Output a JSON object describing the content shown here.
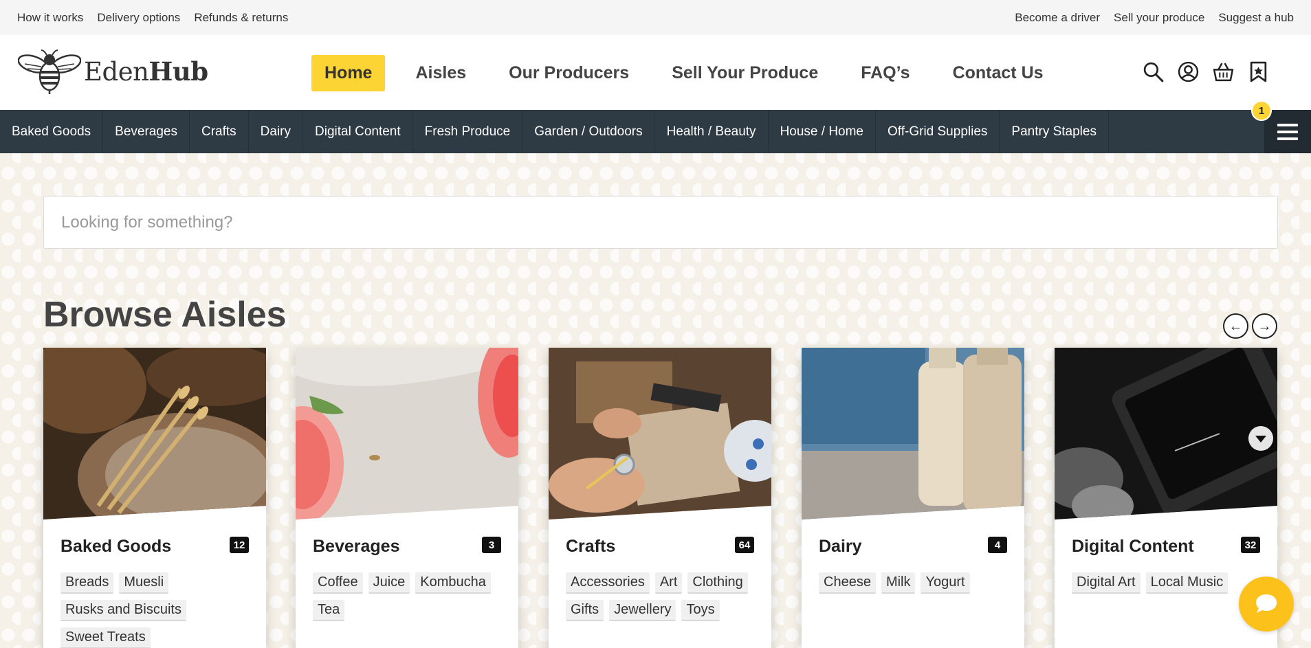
{
  "util_nav": {
    "left": [
      {
        "label": "How it works"
      },
      {
        "label": "Delivery options"
      },
      {
        "label": "Refunds & returns"
      }
    ],
    "right": [
      {
        "label": "Become a driver"
      },
      {
        "label": "Sell your produce"
      },
      {
        "label": "Suggest a hub"
      }
    ]
  },
  "brand": {
    "name_light": "Eden",
    "name_bold": "Hub",
    "icon": "bee-icon"
  },
  "main_nav": [
    {
      "label": "Home",
      "active": true
    },
    {
      "label": "Aisles"
    },
    {
      "label": "Our Producers"
    },
    {
      "label": "Sell Your Produce"
    },
    {
      "label": "FAQ’s"
    },
    {
      "label": "Contact Us"
    }
  ],
  "header_icons": [
    "search-icon",
    "user-icon",
    "basket-icon",
    "bookmark-icon"
  ],
  "cart_count": "1",
  "categories": [
    {
      "label": "Baked Goods"
    },
    {
      "label": "Beverages"
    },
    {
      "label": "Crafts"
    },
    {
      "label": "Dairy"
    },
    {
      "label": "Digital Content"
    },
    {
      "label": "Fresh Produce"
    },
    {
      "label": "Garden / Outdoors"
    },
    {
      "label": "Health / Beauty"
    },
    {
      "label": "House / Home"
    },
    {
      "label": "Off-Grid Supplies"
    },
    {
      "label": "Pantry Staples"
    }
  ],
  "search": {
    "placeholder": "Looking for something?"
  },
  "browse": {
    "title": "Browse Aisles",
    "prev_icon": "arrow-left-icon",
    "next_icon": "arrow-right-icon"
  },
  "aisles": [
    {
      "title": "Baked Goods",
      "count": "12",
      "tags": [
        "Breads",
        "Muesli",
        "Rusks and Biscuits",
        "Sweet Treats"
      ]
    },
    {
      "title": "Beverages",
      "count": "3",
      "tags": [
        "Coffee",
        "Juice",
        "Kombucha",
        "Tea"
      ]
    },
    {
      "title": "Crafts",
      "count": "64",
      "tags": [
        "Accessories",
        "Art",
        "Clothing",
        "Gifts",
        "Jewellery",
        "Toys"
      ]
    },
    {
      "title": "Dairy",
      "count": "4",
      "tags": [
        "Cheese",
        "Milk",
        "Yogurt"
      ]
    },
    {
      "title": "Digital Content",
      "count": "32",
      "tags": [
        "Digital Art",
        "Local Music"
      ]
    }
  ],
  "colors": {
    "accent": "#fcd535",
    "catbar": "#2f3b44",
    "chat": "#fcc21b"
  },
  "chat_icon": "chat-bubble-icon"
}
